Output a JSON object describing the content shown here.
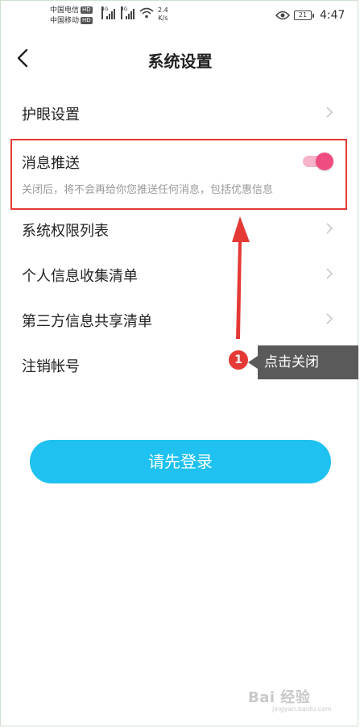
{
  "status_bar": {
    "carrier_1": "中国电信",
    "carrier_2": "中国移动",
    "hd_label": "HD",
    "network_1": "4G",
    "network_2": "4G",
    "speed_value": "2.4",
    "speed_unit": "K/s",
    "battery": "21",
    "time": "4:47"
  },
  "header": {
    "title": "系统设置"
  },
  "settings": {
    "eye_protection": "护眼设置",
    "push_notifications": {
      "label": "消息推送",
      "description": "关闭后，将不会再给你您推送任何消息，包括优惠信息",
      "enabled": true
    },
    "permissions_list": "系统权限列表",
    "personal_info_list": "个人信息收集清单",
    "third_party_list": "第三方信息共享清单",
    "delete_account": "注销帐号"
  },
  "login_button": "请先登录",
  "annotation": {
    "step": "1",
    "tooltip": "点击关闭"
  },
  "watermark": {
    "main": "Bai 经验",
    "sub": "jingyan.baidu.com"
  },
  "colors": {
    "accent": "#1ec1ef",
    "toggle_on": "#ef4d7f",
    "annotation": "#e53935"
  }
}
